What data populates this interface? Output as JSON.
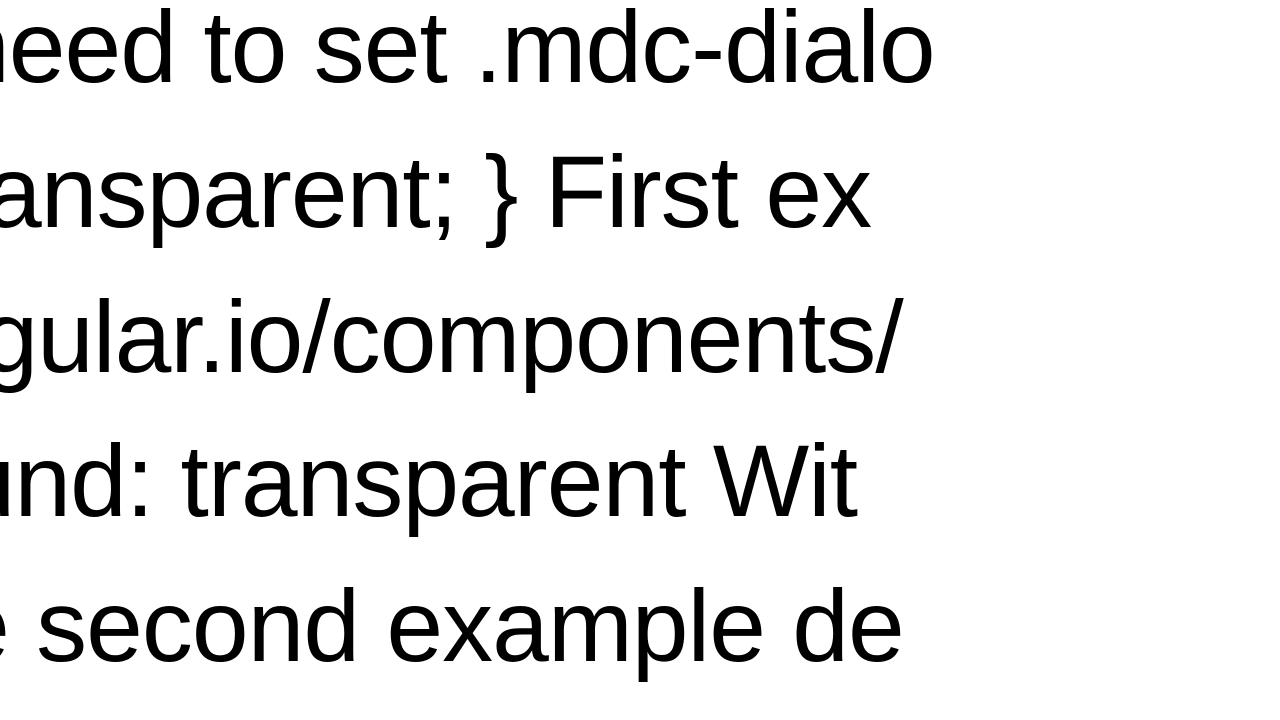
{
  "text": {
    "line1": "u need to set .mdc-dialo",
    "line2": ": transparent; }  First ex",
    "line3": "angular.io/components/",
    "line4": "round: transparent  Wit",
    "line5": "the second example de"
  }
}
